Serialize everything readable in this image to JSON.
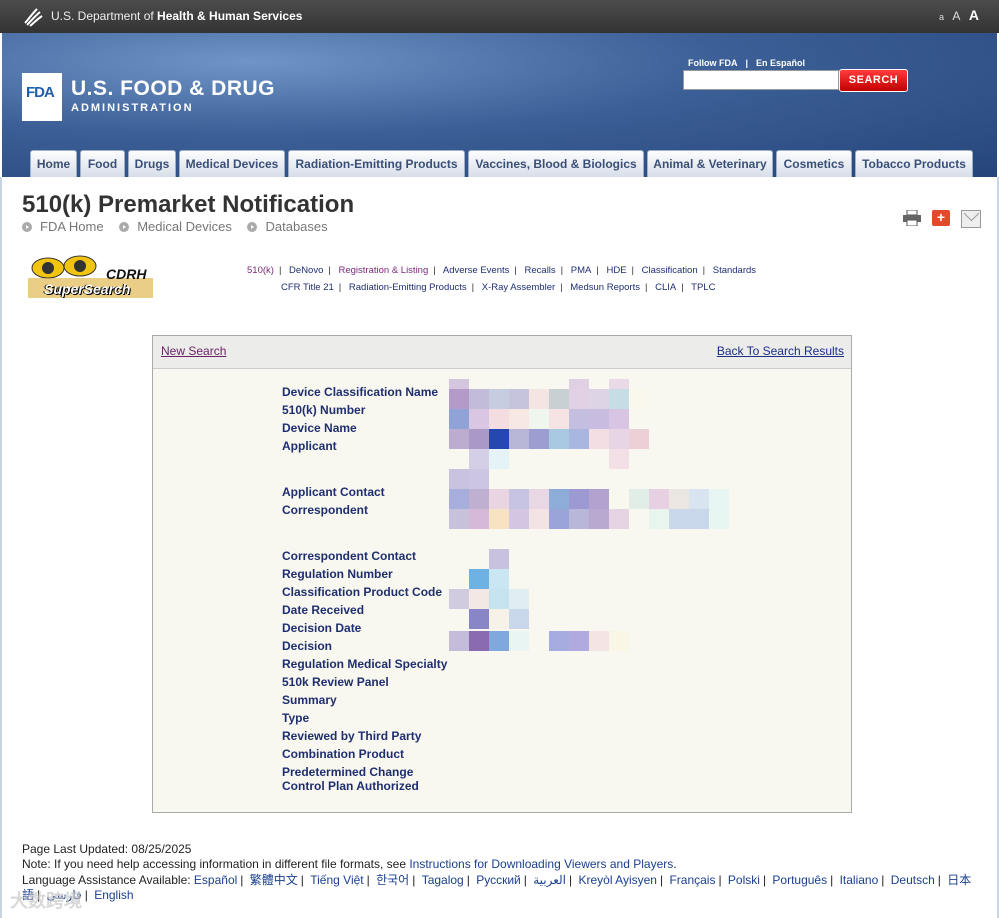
{
  "hhs": {
    "prefix": "U.S. Department of ",
    "bold": "Health & Human Services"
  },
  "font_size": {
    "small": "a",
    "medium": "A",
    "large": "A"
  },
  "fda": {
    "logo": "FDA",
    "title": "U.S. FOOD & DRUG",
    "subtitle": "ADMINISTRATION"
  },
  "header_links": {
    "follow": "Follow FDA",
    "separator": "|",
    "spanish": "En Español"
  },
  "search": {
    "placeholder": "",
    "button": "SEARCH"
  },
  "nav": [
    "Home",
    "Food",
    "Drugs",
    "Medical Devices",
    "Radiation-Emitting Products",
    "Vaccines, Blood & Biologics",
    "Animal & Veterinary",
    "Cosmetics",
    "Tobacco Products"
  ],
  "page": {
    "title": "510(k) Premarket Notification"
  },
  "breadcrumbs": [
    "FDA Home",
    "Medical Devices",
    "Databases"
  ],
  "cdrh": {
    "line1": "CDRH",
    "line2": "SuperSearch"
  },
  "db_links_row1": [
    "510(k)",
    "DeNovo",
    "Registration & Listing",
    "Adverse Events",
    "Recalls",
    "PMA",
    "HDE",
    "Classification",
    "Standards"
  ],
  "db_links_row2": [
    "CFR Title 21",
    "Radiation-Emitting Products",
    "X-Ray Assembler",
    "Medsun Reports",
    "CLIA",
    "TPLC"
  ],
  "panel": {
    "new_search": "New Search",
    "back": "Back To Search Results"
  },
  "fields": [
    "Device Classification Name",
    "510(k) Number",
    "Device Name",
    "Applicant",
    "Applicant Contact",
    "Correspondent",
    "Correspondent Contact",
    "Regulation Number",
    "Classification Product Code",
    "Date Received",
    "Decision Date",
    "Decision",
    "Regulation Medical Specialty",
    "510k Review Panel",
    "Summary",
    "Type",
    "Reviewed by Third Party",
    "Combination Product",
    "Predetermined Change",
    "Control Plan Authorized"
  ],
  "footer": {
    "updated": "Page Last Updated: 08/25/2025",
    "note_prefix": "Note: If you need help accessing information in different file formats, see ",
    "note_link": "Instructions for Downloading Viewers and Players",
    "note_suffix": ".",
    "lang_prefix": "Language Assistance Available: ",
    "languages": [
      "Español",
      "繁體中文",
      "Tiếng Việt",
      "한국어",
      "Tagalog",
      "Русский",
      "العربية",
      "Kreyòl Ayisyen",
      "Français",
      "Polski",
      "Português",
      "Italiano",
      "Deutsch",
      "日本語",
      "فارسی",
      "English"
    ]
  },
  "watermark": "大数跨境"
}
